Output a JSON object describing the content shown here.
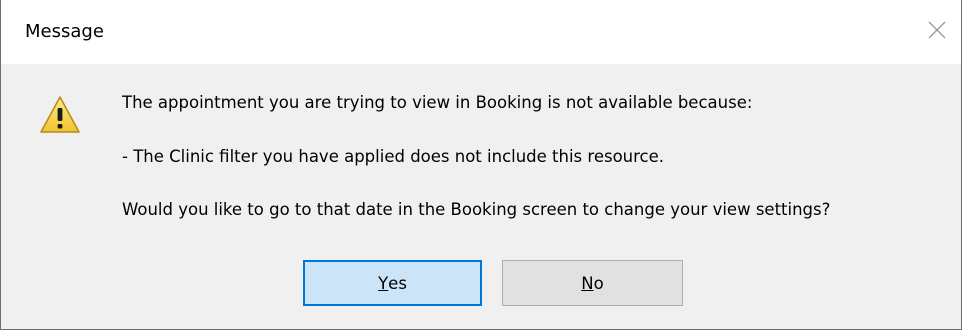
{
  "window": {
    "title": "Message",
    "close_icon": "close-icon"
  },
  "message": {
    "icon": "warning-icon",
    "line1": "The appointment you are trying to view in Booking is not available because:",
    "line2": "- The Clinic filter you have applied does not include this resource.",
    "line3": "Would you like to go to that date in the Booking screen to change your view settings?"
  },
  "buttons": {
    "yes": {
      "mnemonic": "Y",
      "rest": "es"
    },
    "no": {
      "mnemonic": "N",
      "rest": "o"
    }
  },
  "colors": {
    "titlebar_bg": "#ffffff",
    "dialog_bg": "#f0f0f0",
    "default_button_bg": "#cce4f7",
    "default_button_border": "#0078d7",
    "button_bg": "#e1e1e1",
    "warning_yellow": "#f7d548"
  }
}
